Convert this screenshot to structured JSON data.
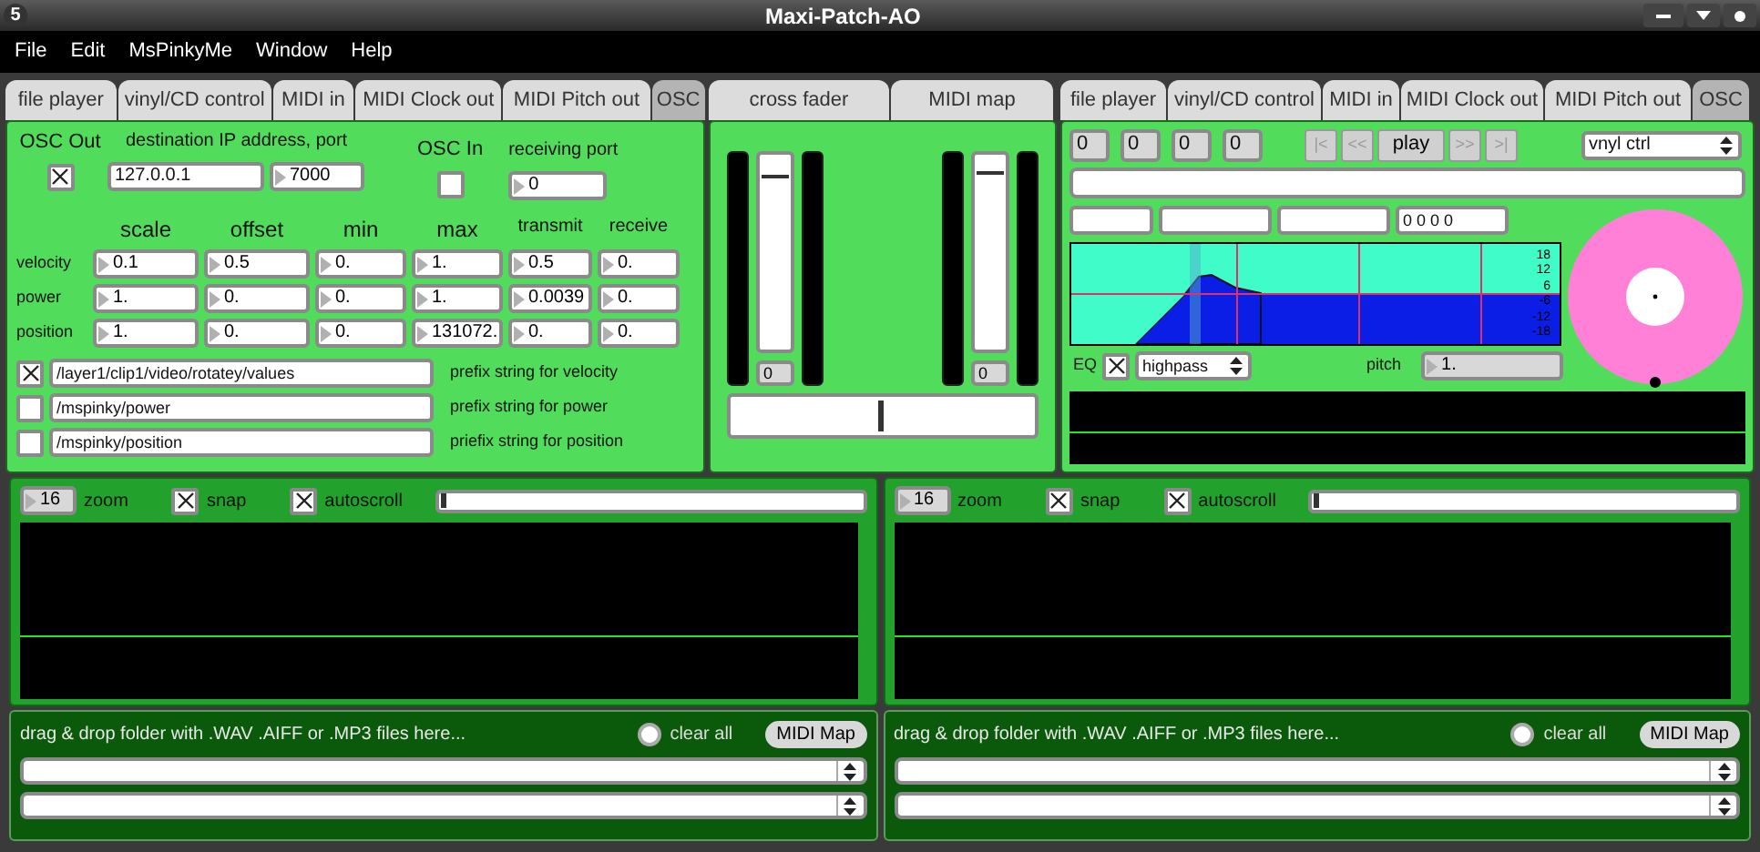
{
  "window": {
    "title": "Maxi-Patch-AO",
    "app_icon": "5"
  },
  "menu": [
    "File",
    "Edit",
    "MsPinkyMe",
    "Window",
    "Help"
  ],
  "left_tabs": [
    {
      "label": "file player",
      "selected": false
    },
    {
      "label": "vinyl/CD control",
      "selected": false
    },
    {
      "label": "MIDI in",
      "selected": false
    },
    {
      "label": "MIDI Clock out",
      "selected": false
    },
    {
      "label": "MIDI Pitch out",
      "selected": false
    },
    {
      "label": "OSC",
      "selected": true
    }
  ],
  "osc": {
    "out_label": "OSC Out",
    "out_checked": true,
    "dest_label": "destination IP address, port",
    "ip": "127.0.0.1",
    "port": "7000",
    "in_label": "OSC In",
    "in_checked": false,
    "recv_label": "receiving port",
    "recv_port": "0",
    "columns": [
      "scale",
      "offset",
      "min",
      "max",
      "transmit",
      "receive"
    ],
    "rows": [
      {
        "label": "velocity",
        "values": [
          "0.1",
          "0.5",
          "0.",
          "1.",
          "0.5",
          "0."
        ]
      },
      {
        "label": "power",
        "values": [
          "1.",
          "0.",
          "0.",
          "1.",
          "0.0039",
          "0."
        ]
      },
      {
        "label": "position",
        "values": [
          "1.",
          "0.",
          "0.",
          "131072.",
          "0.",
          "0."
        ]
      }
    ],
    "prefixes": [
      {
        "checked": true,
        "value": "/layer1/clip1/video/rotatey/values",
        "label": "prefix string for velocity"
      },
      {
        "checked": false,
        "value": "/mspinky/power",
        "label": "prefix string for power"
      },
      {
        "checked": false,
        "value": "/mspinky/position",
        "label": "priefix string for position"
      }
    ]
  },
  "mixer_tabs": [
    {
      "label": "cross fader",
      "selected": false
    },
    {
      "label": "MIDI map",
      "selected": false
    }
  ],
  "mixer": {
    "faders": [
      {
        "level": 0.9,
        "value": "0"
      },
      {
        "level": 0.91,
        "value": "0"
      }
    ],
    "crossfader": {
      "level": 0.49
    }
  },
  "right_tabs": [
    {
      "label": "file player",
      "selected": false
    },
    {
      "label": "vinyl/CD control",
      "selected": false
    },
    {
      "label": "MIDI in",
      "selected": false
    },
    {
      "label": "MIDI Clock out",
      "selected": false
    },
    {
      "label": "MIDI Pitch out",
      "selected": false
    },
    {
      "label": "OSC",
      "selected": true
    }
  ],
  "player": {
    "counters": [
      "0",
      "0",
      "0",
      "0"
    ],
    "transport": [
      {
        "label": "|<",
        "disabled": true
      },
      {
        "label": "<<",
        "disabled": true
      },
      {
        "label": "play",
        "disabled": false
      },
      {
        "label": ">>",
        "disabled": true
      },
      {
        "label": ">|",
        "disabled": true
      }
    ],
    "mode": "vnyl ctrl",
    "position": "0 0 0 0",
    "eq_scale": [
      "18",
      "12",
      "6",
      "-6",
      "-12",
      "-18"
    ],
    "eq_label": "EQ",
    "eq_checked": true,
    "eq_filter": "highpass",
    "pitch_label": "pitch",
    "pitch_value": "1."
  },
  "tracks": [
    {
      "zoom": "16",
      "zoom_label": "zoom",
      "snap_label": "snap",
      "snap_checked": true,
      "autoscroll_label": "autoscroll",
      "autoscroll_checked": true
    },
    {
      "zoom": "16",
      "zoom_label": "zoom",
      "snap_label": "snap",
      "snap_checked": true,
      "autoscroll_label": "autoscroll",
      "autoscroll_checked": true
    }
  ],
  "browsers": [
    {
      "hint": "drag & drop folder with .WAV .AIFF or .MP3 files here...",
      "clear_label": "clear all",
      "clear_on": false,
      "midi_button": "MIDI Map"
    },
    {
      "hint": "drag & drop folder with .WAV .AIFF or .MP3 files here...",
      "clear_label": "clear all",
      "clear_on": false,
      "midi_button": "MIDI Map"
    }
  ]
}
